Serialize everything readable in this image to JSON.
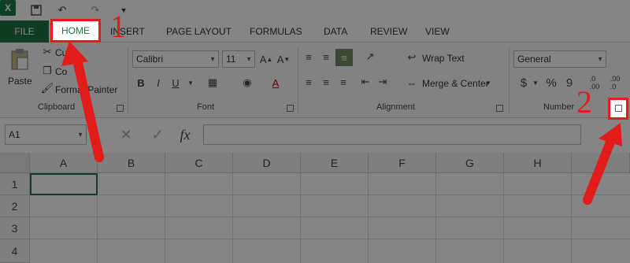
{
  "titlebar": {
    "app_icon": "excel-icon",
    "qa_icons": [
      "save-icon",
      "undo-icon",
      "redo-icon",
      "customize-icon"
    ]
  },
  "tabs": [
    {
      "label": "FILE",
      "name": "tab-file"
    },
    {
      "label": "HOME",
      "name": "tab-home"
    },
    {
      "label": "INSERT",
      "name": "tab-insert"
    },
    {
      "label": "PAGE LAYOUT",
      "name": "tab-page-layout"
    },
    {
      "label": "FORMULAS",
      "name": "tab-formulas"
    },
    {
      "label": "DATA",
      "name": "tab-data"
    },
    {
      "label": "REVIEW",
      "name": "tab-review"
    },
    {
      "label": "VIEW",
      "name": "tab-view"
    }
  ],
  "ribbon": {
    "clipboard": {
      "paste_label": "Paste",
      "cut_label": "Cut",
      "copy_label": "Co",
      "format_painter_label": "Format Painter",
      "group_label": "Clipboard"
    },
    "font": {
      "font_name": "Calibri",
      "font_size": "11",
      "bold": "B",
      "italic": "I",
      "underline": "U",
      "group_label": "Font"
    },
    "alignment": {
      "wrap_text_label": "Wrap Text",
      "merge_center_label": "Merge & Center",
      "group_label": "Alignment"
    },
    "number": {
      "format": "General",
      "currency": "$",
      "percent": "%",
      "comma": "9",
      "group_label": "Number"
    }
  },
  "formula_bar": {
    "name_box": "A1",
    "fx_label": "fx",
    "value": ""
  },
  "grid": {
    "columns": [
      "A",
      "B",
      "C",
      "D",
      "E",
      "F",
      "G",
      "H"
    ],
    "rows": [
      "1",
      "2",
      "3",
      "4"
    ]
  },
  "annotations": {
    "step1": "1",
    "step2": "2",
    "color": "#e21b1b"
  },
  "colors": {
    "excel_green": "#217346",
    "highlight_red": "#e21b1b"
  }
}
